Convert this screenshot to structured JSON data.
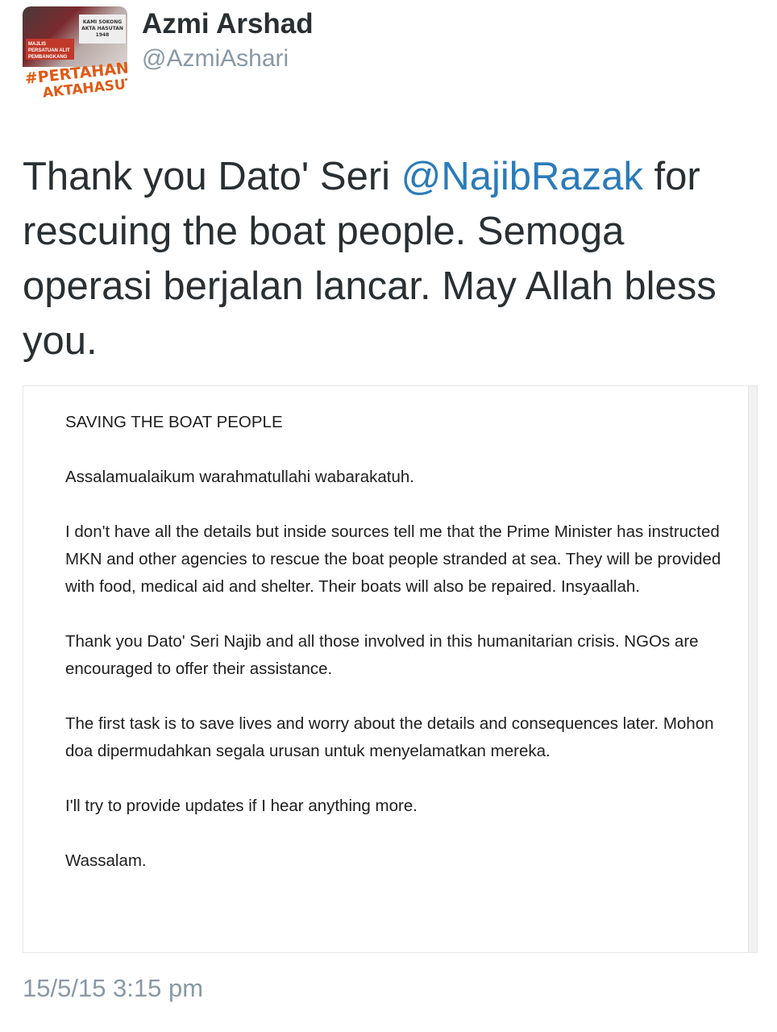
{
  "tweet": {
    "author": {
      "display_name": "Azmi Arshad",
      "handle": "@AzmiAshari",
      "avatar": {
        "plate_text": "KAMI SOKONG AKTA HASUTAN 1948",
        "banner_text": "MAJLIS PERSATUAN ALIT PEMBANGKANG",
        "hashtag_line1": "#PERTAHAN",
        "hashtag_line2": "AKTAHASUTAN"
      }
    },
    "text_parts": {
      "before": "Thank you Dato' Seri ",
      "mention": "@NajibRazak",
      "after": " for rescuing the boat people. Semoga operasi berjalan lancar. May Allah bless you."
    },
    "attachment": {
      "title": "SAVING THE BOAT PEOPLE",
      "paragraphs": [
        "Assalamualaikum warahmatullahi wabarakatuh.",
        "I don't have all the details but inside sources tell me that the Prime Minister has instructed MKN and other agencies to rescue the boat people stranded at sea. They will be provided with food, medical aid and shelter. Their boats will also be repaired. Insyaallah.",
        "Thank you Dato' Seri Najib and all those involved in this humanitarian crisis. NGOs are encouraged to offer their assistance.",
        "The first task is to save lives and worry about the details and consequences later. Mohon doa dipermudahkan segala urusan untuk menyelamatkan mereka.",
        "I'll try to provide updates if I hear anything more.",
        "Wassalam."
      ]
    },
    "timestamp": "15/5/15 3:15 pm"
  },
  "colors": {
    "text": "#292f33",
    "mention": "#2b7bb9",
    "secondary": "#8899a6",
    "hashtag": "#e05a14"
  }
}
